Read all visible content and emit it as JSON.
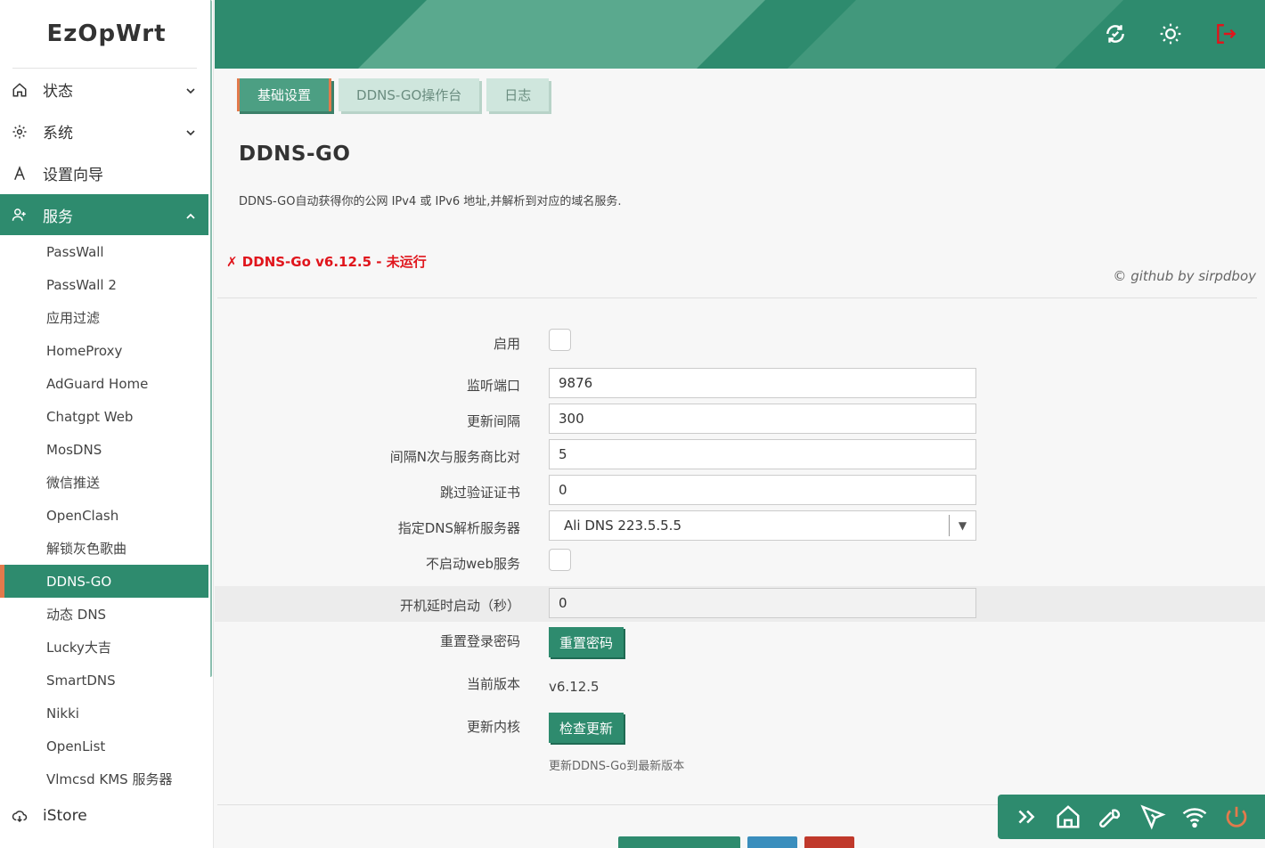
{
  "brand": "EzOpWrt",
  "sidebar": {
    "menu": [
      {
        "label": "状态",
        "icon": "home-icon"
      },
      {
        "label": "系统",
        "icon": "gear-icon"
      },
      {
        "label": "设置向导",
        "icon": "wizard-icon"
      }
    ],
    "services": {
      "label": "服务",
      "items": [
        "PassWall",
        "PassWall 2",
        "应用过滤",
        "HomeProxy",
        "AdGuard Home",
        "Chatgpt Web",
        "MosDNS",
        "微信推送",
        "OpenClash",
        "解锁灰色歌曲",
        "DDNS-GO",
        "动态 DNS",
        "Lucky大吉",
        "SmartDNS",
        "Nikki",
        "OpenList",
        "Vlmcsd KMS 服务器"
      ],
      "active": "DDNS-GO"
    },
    "istore": "iStore"
  },
  "tabs": [
    {
      "label": "基础设置",
      "active": true
    },
    {
      "label": "DDNS-GO操作台",
      "active": false
    },
    {
      "label": "日志",
      "active": false
    }
  ],
  "page": {
    "title": "DDNS-GO",
    "description": "DDNS-GO自动获得你的公网 IPv4 或 IPv6 地址,并解析到对应的域名服务.",
    "status": "✗ DDNS-Go v6.12.5 - 未运行",
    "credit": "© github by sirpdboy"
  },
  "form": {
    "enable_label": "启用",
    "port_label": "监听端口",
    "port_value": "9876",
    "interval_label": "更新间隔",
    "interval_value": "300",
    "compare_label": "间隔N次与服务商比对",
    "compare_value": "5",
    "skip_cert_label": "跳过验证证书",
    "skip_cert_value": "0",
    "dns_label": "指定DNS解析服务器",
    "dns_value": "Ali DNS 223.5.5.5",
    "noweb_label": "不启动web服务",
    "delay_label": "开机延时启动（秒）",
    "delay_value": "0",
    "reset_label": "重置登录密码",
    "reset_button": "重置密码",
    "version_label": "当前版本",
    "version_value": "v6.12.5",
    "core_label": "更新内核",
    "core_button": "检查更新",
    "core_hint": "更新DDNS-Go到最新版本"
  },
  "colors": {
    "primary": "#2e8b6e",
    "accent": "#e27a4c",
    "danger": "#e0151c"
  }
}
